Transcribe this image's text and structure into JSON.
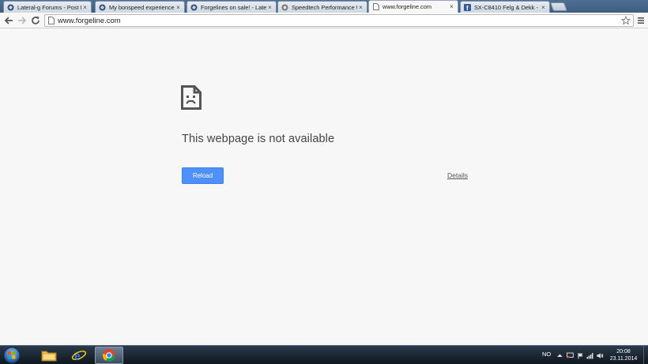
{
  "tabs": [
    {
      "title": "Lateral-g Forums - Post N",
      "favicon": "lateral-g-icon"
    },
    {
      "title": "My bonspeed experience",
      "favicon": "lateral-g-icon"
    },
    {
      "title": "Forgelines on sale! - Latera",
      "favicon": "lateral-g-icon"
    },
    {
      "title": "Speedtech Performance U",
      "favicon": "speedtech-icon"
    },
    {
      "title": "www.forgeline.com",
      "favicon": "page-icon",
      "active": true
    },
    {
      "title": "SX-C8410 Felg & Dekk - FI",
      "favicon": "facebook-icon"
    }
  ],
  "toolbar": {
    "url": "www.forgeline.com"
  },
  "error": {
    "title": "This webpage is not available",
    "reload_label": "Reload",
    "details_label": "Details"
  },
  "taskbar": {
    "language": "NO",
    "time": "20:08",
    "date": "23.11.2014"
  },
  "colors": {
    "accent_button": "#4d90fe",
    "page_background": "#f7f7f7",
    "text": "#444444"
  }
}
